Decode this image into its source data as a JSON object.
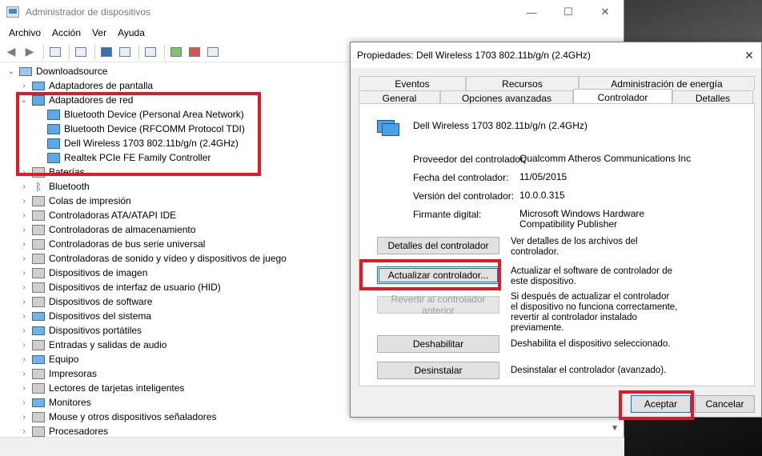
{
  "device_manager": {
    "title": "Administrador de dispositivos",
    "window_controls": {
      "minimize": "—",
      "maximize": "☐",
      "close": "✕"
    },
    "menu": [
      "Archivo",
      "Acción",
      "Ver",
      "Ayuda"
    ],
    "tree": [
      {
        "label": "Downloadsource",
        "chevron": "⌄",
        "icon": "computer"
      },
      {
        "label": "Adaptadores de pantalla",
        "chevron": "›",
        "icon": "display-adapter"
      },
      {
        "label": "Adaptadores de red",
        "chevron": "⌄",
        "icon": "network-adapter"
      },
      {
        "label": "Bluetooth Device (Personal Area Network)",
        "chevron": "",
        "icon": "network-adapter"
      },
      {
        "label": "Bluetooth Device (RFCOMM Protocol TDI)",
        "chevron": "",
        "icon": "network-adapter"
      },
      {
        "label": "Dell Wireless 1703 802.11b/g/n (2.4GHz)",
        "chevron": "",
        "icon": "network-adapter"
      },
      {
        "label": "Realtek PCIe FE Family Controller",
        "chevron": "",
        "icon": "network-adapter"
      },
      {
        "label": "Baterías",
        "chevron": "›",
        "icon": "battery"
      },
      {
        "label": "Bluetooth",
        "chevron": "›",
        "icon": "bluetooth"
      },
      {
        "label": "Colas de impresión",
        "chevron": "›",
        "icon": "print-queue"
      },
      {
        "label": "Controladoras ATA/ATAPI IDE",
        "chevron": "›",
        "icon": "ide-controller"
      },
      {
        "label": "Controladoras de almacenamiento",
        "chevron": "›",
        "icon": "storage-controller"
      },
      {
        "label": "Controladoras de bus serie universal",
        "chevron": "›",
        "icon": "usb"
      },
      {
        "label": "Controladoras de sonido y vídeo y dispositivos de juego",
        "chevron": "›",
        "icon": "sound"
      },
      {
        "label": "Dispositivos de imagen",
        "chevron": "›",
        "icon": "camera"
      },
      {
        "label": "Dispositivos de interfaz de usuario (HID)",
        "chevron": "›",
        "icon": "hid"
      },
      {
        "label": "Dispositivos de software",
        "chevron": "›",
        "icon": "software-device"
      },
      {
        "label": "Dispositivos del sistema",
        "chevron": "›",
        "icon": "system-device"
      },
      {
        "label": "Dispositivos portátiles",
        "chevron": "›",
        "icon": "portable-device"
      },
      {
        "label": "Entradas y salidas de audio",
        "chevron": "›",
        "icon": "audio"
      },
      {
        "label": "Equipo",
        "chevron": "›",
        "icon": "computer"
      },
      {
        "label": "Impresoras",
        "chevron": "›",
        "icon": "printer"
      },
      {
        "label": "Lectores de tarjetas inteligentes",
        "chevron": "›",
        "icon": "smart-card"
      },
      {
        "label": "Monitores",
        "chevron": "›",
        "icon": "monitor"
      },
      {
        "label": "Mouse y otros dispositivos señaladores",
        "chevron": "›",
        "icon": "mouse"
      },
      {
        "label": "Procesadores",
        "chevron": "›",
        "icon": "processor"
      }
    ]
  },
  "properties_dialog": {
    "title": "Propiedades: Dell Wireless 1703 802.11b/g/n (2.4GHz)",
    "close": "✕",
    "tabs_top": [
      "Eventos",
      "Recursos",
      "Administración de energía"
    ],
    "tabs_bottom": [
      "General",
      "Opciones avanzadas",
      "Controlador",
      "Detalles"
    ],
    "active_tab": "Controlador",
    "device_name": "Dell Wireless 1703 802.11b/g/n (2.4GHz)",
    "fields": [
      {
        "label": "Proveedor del controlador:",
        "value": "Qualcomm Atheros Communications Inc"
      },
      {
        "label": "Fecha del controlador:",
        "value": "11/05/2015"
      },
      {
        "label": "Versión del controlador:",
        "value": "10.0.0.315"
      },
      {
        "label": "Firmante digital:",
        "value": "Microsoft Windows Hardware Compatibility Publisher"
      }
    ],
    "actions": [
      {
        "label": "Detalles del controlador",
        "desc": "Ver detalles de los archivos del controlador."
      },
      {
        "label": "Actualizar controlador...",
        "desc": "Actualizar el software de controlador de este dispositivo."
      },
      {
        "label": "Revertir al controlador anterior",
        "desc": "Si después de actualizar el controlador el dispositivo no funciona correctamente, revertir al controlador instalado previamente."
      },
      {
        "label": "Deshabilitar",
        "desc": "Deshabilita el dispositivo seleccionado."
      },
      {
        "label": "Desinstalar",
        "desc": "Desinstalar el controlador (avanzado)."
      }
    ],
    "ok_label": "Aceptar",
    "cancel_label": "Cancelar"
  },
  "colors": {
    "highlight_red": "#e0192a",
    "focus_blue": "#0078d7"
  }
}
